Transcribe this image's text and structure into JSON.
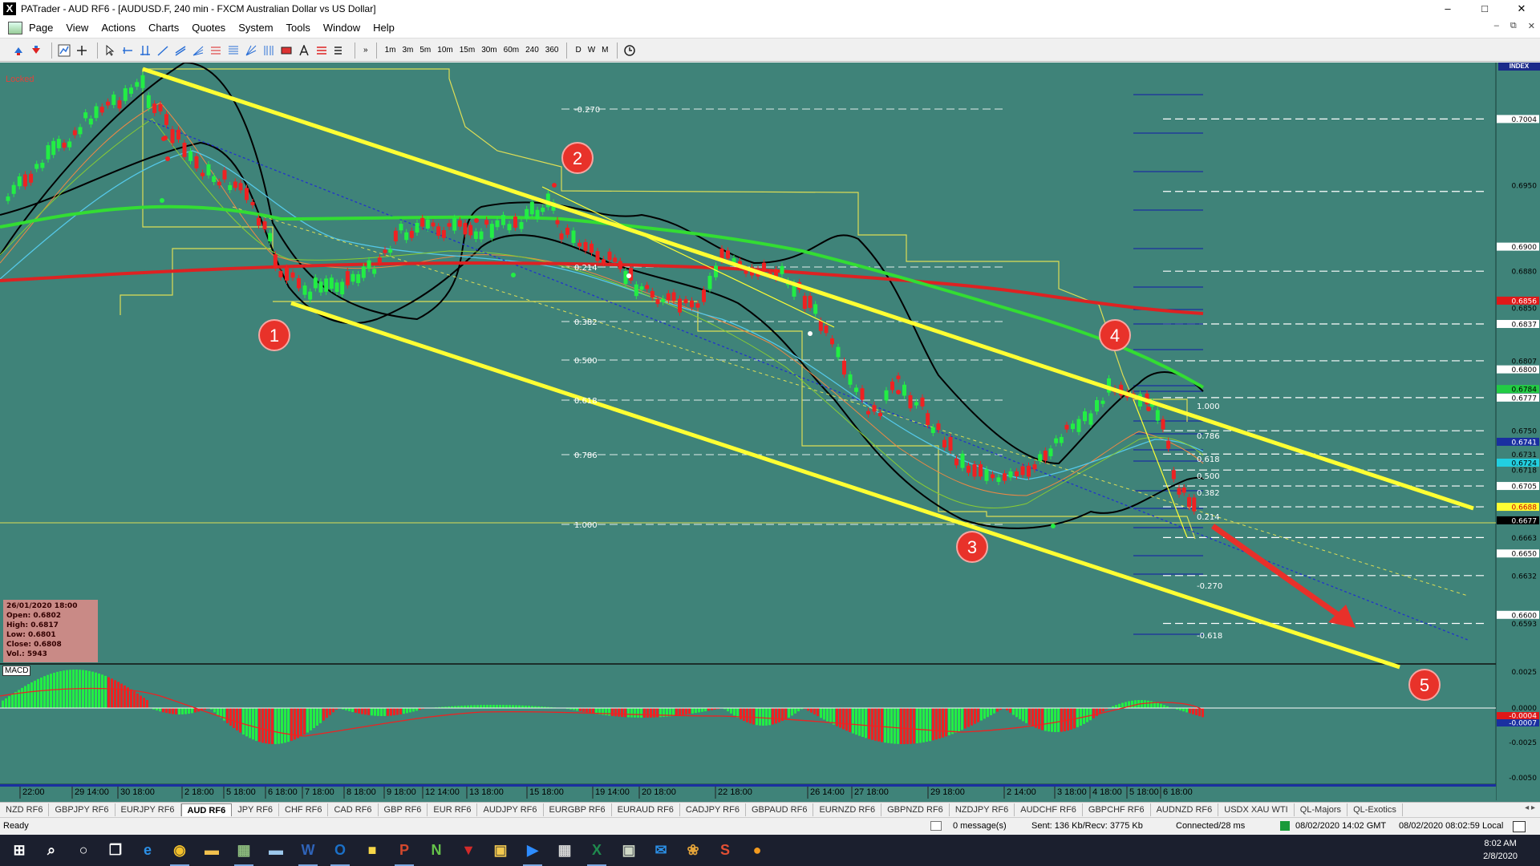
{
  "window": {
    "title": "PATrader - AUD RF6 - [AUDUSD.F, 240 min - FXCM Australian Dollar vs US Dollar]",
    "app_icon_letter": "X",
    "minimize": "–",
    "maximize": "□",
    "close": "✕"
  },
  "menu": {
    "items": [
      "Page",
      "View",
      "Actions",
      "Charts",
      "Quotes",
      "System",
      "Tools",
      "Window",
      "Help"
    ],
    "mdi_minimize": "–",
    "mdi_restore": "⧉",
    "mdi_close": "✕"
  },
  "toolbar": {
    "timeframes": [
      "1m",
      "3m",
      "5m",
      "10m",
      "15m",
      "30m",
      "60m",
      "240",
      "360"
    ],
    "periods": [
      "D",
      "W",
      "M"
    ],
    "more": "»"
  },
  "chart": {
    "locked_label": "Locked",
    "index_label": "INDEX",
    "macd_label": "MACD",
    "colors": {
      "background": "#3f8379",
      "channel": "#ffff33",
      "ma_red": "#dd2222",
      "ma_green": "#33dd33",
      "bull": "#22ee44",
      "bear": "#ee2222",
      "bollinger": "#000000",
      "step_line": "#dddd55"
    },
    "price_axis_labels": [
      "0.7004",
      "0.6950",
      "0.6900",
      "0.6880",
      "0.6856",
      "0.6850",
      "0.6837",
      "0.6807",
      "0.6800",
      "0.6784",
      "0.6777",
      "0.6750",
      "0.6741",
      "0.6731",
      "0.6724",
      "0.6718",
      "0.6705",
      "0.6688",
      "0.6677",
      "0.6663",
      "0.6650",
      "0.6632",
      "0.6600",
      "0.6593"
    ],
    "highlighted_price_labels": {
      "red": "0.6856",
      "green": "0.6784",
      "cyan": "0.6724",
      "blue": "0.6741",
      "yellow": "0.6688",
      "black": "0.6677"
    },
    "macd_axis_labels": [
      "0.0025",
      "0.0000",
      "-0.0025",
      "-0.0050"
    ],
    "macd_value_red": "-0.0004",
    "macd_value_blue": "-0.0007",
    "fib_left": [
      "-0.270",
      "0.214",
      "0.382",
      "0.500",
      "0.618",
      "0.786",
      "1.000"
    ],
    "fib_right": [
      "1.000",
      "0.786",
      "0.618",
      "0.500",
      "0.382",
      "0.214",
      "-0.270",
      "-0.618"
    ],
    "markers": [
      "1",
      "2",
      "3",
      "4",
      "5"
    ],
    "time_labels": [
      "22:00",
      "29 14:00",
      "30 18:00",
      "2 18:00",
      "5 18:00",
      "6 18:00",
      "7 18:00",
      "8 18:00",
      "9 18:00",
      "12 14:00",
      "13 18:00",
      "15 18:00",
      "19 14:00",
      "20 18:00",
      "22 18:00",
      "26 14:00",
      "27 18:00",
      "29 18:00",
      "2 14:00",
      "3 18:00",
      "4 18:00",
      "5 18:00",
      "6 18:00"
    ]
  },
  "ohlc": {
    "date": "26/01/2020 18:00",
    "open": "Open: 0.6802",
    "high": "High: 0.6817",
    "low": "Low: 0.6801",
    "close": "Close: 0.6808",
    "vol": "Vol.: 5943"
  },
  "sheet_tabs": {
    "items": [
      "NZD RF6",
      "GBPJPY RF6",
      "EURJPY RF6",
      "AUD RF6",
      "JPY RF6",
      "CHF RF6",
      "CAD RF6",
      "GBP RF6",
      "EUR RF6",
      "AUDJPY RF6",
      "EURGBP RF6",
      "EURAUD RF6",
      "CADJPY RF6",
      "GBPAUD RF6",
      "EURNZD RF6",
      "GBPNZD RF6",
      "NZDJPY RF6",
      "AUDCHF RF6",
      "GBPCHF RF6",
      "AUDNZD RF6",
      "USDX XAU WTI",
      "QL-Majors",
      "QL-Exotics"
    ],
    "active": "AUD RF6"
  },
  "status": {
    "ready": "Ready",
    "messages": "0 message(s)",
    "traffic": "Sent: 136 Kb/Recv: 3775 Kb",
    "connection": "Connected/28 ms",
    "server_time": "08/02/2020 14:02 GMT",
    "local_time": "08/02/2020 08:02:59 Local"
  },
  "taskbar": {
    "time": "8:02 AM",
    "date": "2/8/2020",
    "apps": [
      "windows-start",
      "search",
      "cortana",
      "task-view",
      "edge",
      "chrome",
      "file-explorer",
      "patrader",
      "notepad",
      "word",
      "outlook",
      "sticky",
      "powerpoint",
      "ninja",
      "app-red",
      "app-folder",
      "zoom",
      "calculator",
      "excel",
      "image-viewer",
      "outlook-2",
      "paint",
      "app-s",
      "app-orange"
    ]
  }
}
